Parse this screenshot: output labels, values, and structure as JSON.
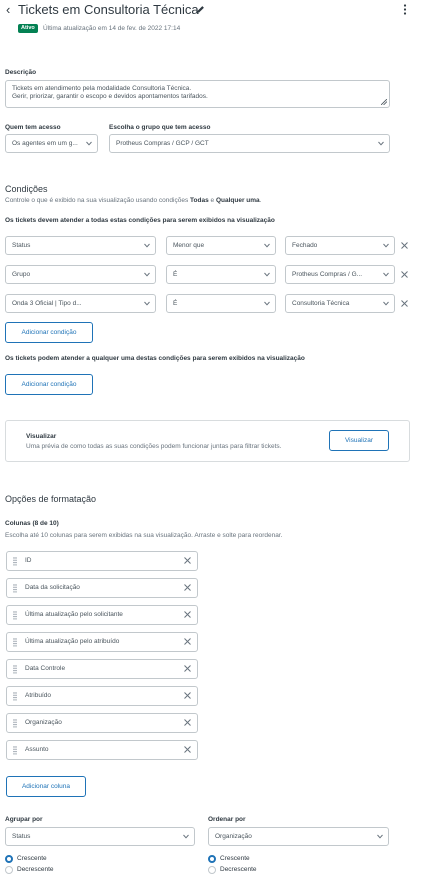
{
  "header": {
    "title": "Tickets em Consultoria Técnica",
    "badge": "Ativo",
    "updated": "Última atualização em 14 de fev. de 2022 17:14"
  },
  "description": {
    "label": "Descrição",
    "line1": "Tickets em atendimento pela modalidade Consultoria Técnica.",
    "line2": "Gerir, priorizar, garantir o escopo e devidos apontamentos tarifados."
  },
  "access": {
    "who_label": "Quem tem acesso",
    "who_value": "Os agentes em um g...",
    "group_label": "Escolha o grupo que tem acesso",
    "group_value": "Protheus Compras / GCP / GCT"
  },
  "conditions": {
    "title": "Condições",
    "hint_prefix": "Controle o que é exibido na sua visualização usando condições",
    "hint_all": "Todas",
    "hint_and": "e",
    "hint_any": "Qualquer uma",
    "hint_suffix": ".",
    "all_label": "Os tickets devem atender a todas estas condições para serem exibidos na visualização",
    "rows": [
      {
        "field": "Status",
        "op": "Menor que",
        "value": "Fechado"
      },
      {
        "field": "Grupo",
        "op": "É",
        "value": "Protheus Compras / G..."
      },
      {
        "field": "Onda 3 Oficial | Tipo d...",
        "op": "É",
        "value": "Consultoria Técnica"
      }
    ],
    "add_label": "Adicionar condição",
    "any_label": "Os tickets podem atender a qualquer uma destas condições para serem exibidos na visualização",
    "add_any_label": "Adicionar condição"
  },
  "preview": {
    "title": "Visualizar",
    "hint": "Uma prévia de como todas as suas condições podem funcionar juntas para filtrar tickets.",
    "button": "Visualizar"
  },
  "format": {
    "title": "Opções de formatação",
    "columns_label": "Colunas (8 de 10)",
    "columns_hint": "Escolha até 10 colunas para serem exibidas na sua visualização. Arraste e solte para reordenar.",
    "columns": [
      "ID",
      "Data da solicitação",
      "Última atualização pelo solicitante",
      "Última atualização pelo atribuído",
      "Data Controle",
      "Atribuído",
      "Organização",
      "Assunto"
    ],
    "add_column": "Adicionar coluna",
    "group_label": "Agrupar por",
    "group_value": "Status",
    "order_label": "Ordenar por",
    "order_value": "Organização",
    "asc": "Crescente",
    "desc": "Decrescente"
  },
  "colors": {
    "accent": "#1f73b7",
    "badge": "#038153",
    "border": "#c2c8cc"
  }
}
